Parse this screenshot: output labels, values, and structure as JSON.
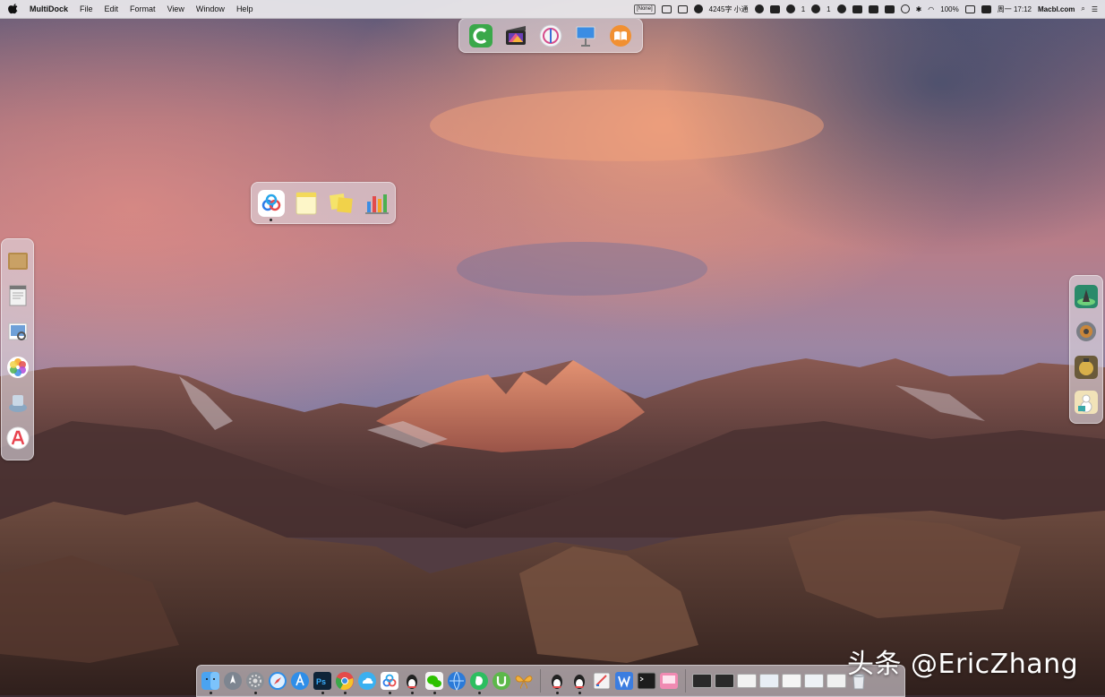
{
  "menubar": {
    "app_name": "MultiDock",
    "menus": [
      "File",
      "Edit",
      "Format",
      "View",
      "Window",
      "Help"
    ],
    "input_badge": "[None]",
    "word_count": "4245字 小通",
    "counter_a": "1",
    "counter_b": "1",
    "battery": "100%",
    "clock": "周一 17:12",
    "site": "Macbl.com"
  },
  "watermark": "头条 @EricZhang",
  "colors": {
    "menubar_bg": "#ecebee",
    "dock_bg": "#ded8e0"
  },
  "dock_top_icons": [
    "coda-icon",
    "final-cut-icon",
    "instruments-icon",
    "keynote-icon",
    "ibooks-icon"
  ],
  "dock_mid_icons": [
    "baidu-netdisk-icon",
    "notes-icon",
    "stickies-icon",
    "numbers-icon"
  ],
  "dock_left_icons": [
    "folder-icon",
    "textedit-icon",
    "preview-icon",
    "photos-icon",
    "migration-icon",
    "app-store-alt-icon"
  ],
  "dock_right_icons": [
    "game-icon",
    "settings-gear-icon",
    "lantern-icon",
    "snowman-icon"
  ],
  "dock_bottom_icons": [
    "finder-icon",
    "launchpad-icon",
    "system-preferences-icon",
    "safari-icon",
    "app-store-icon",
    "photoshop-icon",
    "chrome-icon",
    "cloud-drive-icon",
    "baidu-netdisk-icon",
    "qq-icon",
    "wechat-icon",
    "browser-icon",
    "evernote-icon",
    "utorrent-icon",
    "tes-icon",
    "qq-icon",
    "qq-icon",
    "notefile-icon",
    "word-icon",
    "terminal-icon",
    "cleanmymac-icon"
  ]
}
